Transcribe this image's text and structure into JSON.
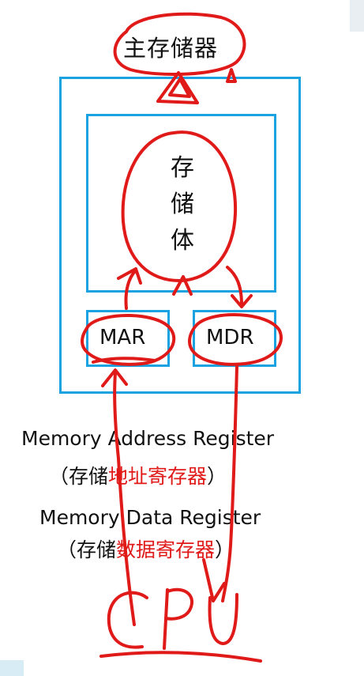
{
  "diagram": {
    "main_memory": "主存储器",
    "storage_body": [
      "存",
      "储",
      "体"
    ],
    "mar": "MAR",
    "mdr": "MDR",
    "cpu": "CPU",
    "mar_full_name": "Memory Address Register",
    "mar_cn_prefix": "（存储",
    "mar_cn_highlight": "地址寄存器",
    "mar_cn_suffix": "）",
    "mdr_full_name": "Memory Data Register",
    "mdr_cn_prefix": "（存储",
    "mdr_cn_highlight": "数据寄存器",
    "mdr_cn_suffix": "）"
  },
  "colors": {
    "box_border": "#1aa3e0",
    "ink_red": "#e01919",
    "text": "#111111"
  }
}
